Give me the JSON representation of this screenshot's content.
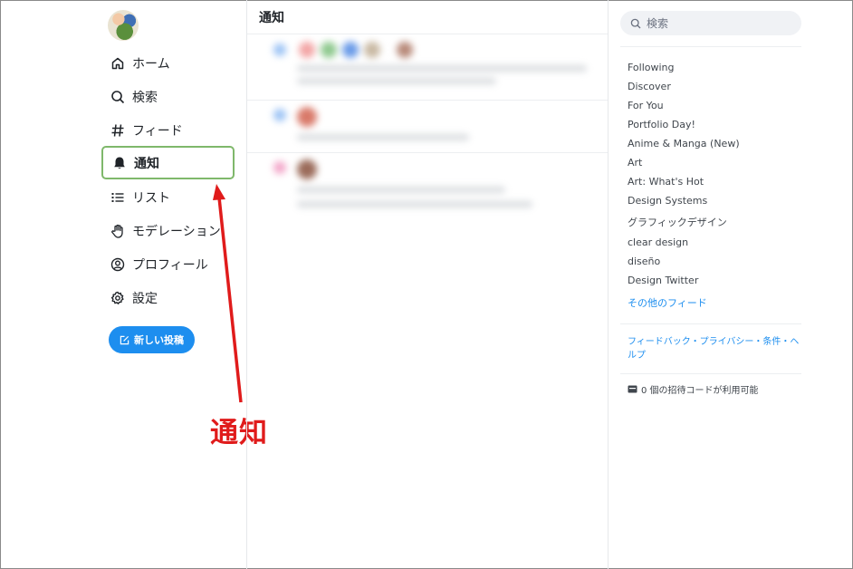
{
  "nav": {
    "items": [
      {
        "label": "ホーム",
        "icon": "home-icon"
      },
      {
        "label": "検索",
        "icon": "search-icon"
      },
      {
        "label": "フィード",
        "icon": "hash-icon"
      },
      {
        "label": "通知",
        "icon": "bell-icon",
        "active": true
      },
      {
        "label": "リスト",
        "icon": "list-icon"
      },
      {
        "label": "モデレーション",
        "icon": "hand-icon"
      },
      {
        "label": "プロフィール",
        "icon": "user-circle-icon"
      },
      {
        "label": "設定",
        "icon": "gear-icon"
      }
    ],
    "new_post_label": "新しい投稿"
  },
  "center": {
    "title": "通知"
  },
  "annotation": {
    "label": "通知",
    "color": "#e01b1b"
  },
  "right": {
    "search_placeholder": "検索",
    "feeds": [
      "Following",
      "Discover",
      "For You",
      "Portfolio Day!",
      "Anime & Manga (New)",
      "Art",
      "Art: What's Hot",
      "Design Systems",
      "グラフィックデザイン",
      "clear design",
      "diseño",
      "Design Twitter"
    ],
    "more_feeds": "その他のフィード",
    "footer": "フィードバック・プライバシー・条件・ヘルプ",
    "invite": "0 個の招待コードが利用可能"
  },
  "colors": {
    "accent": "#1d8eef",
    "active_border": "#7fb86b"
  }
}
